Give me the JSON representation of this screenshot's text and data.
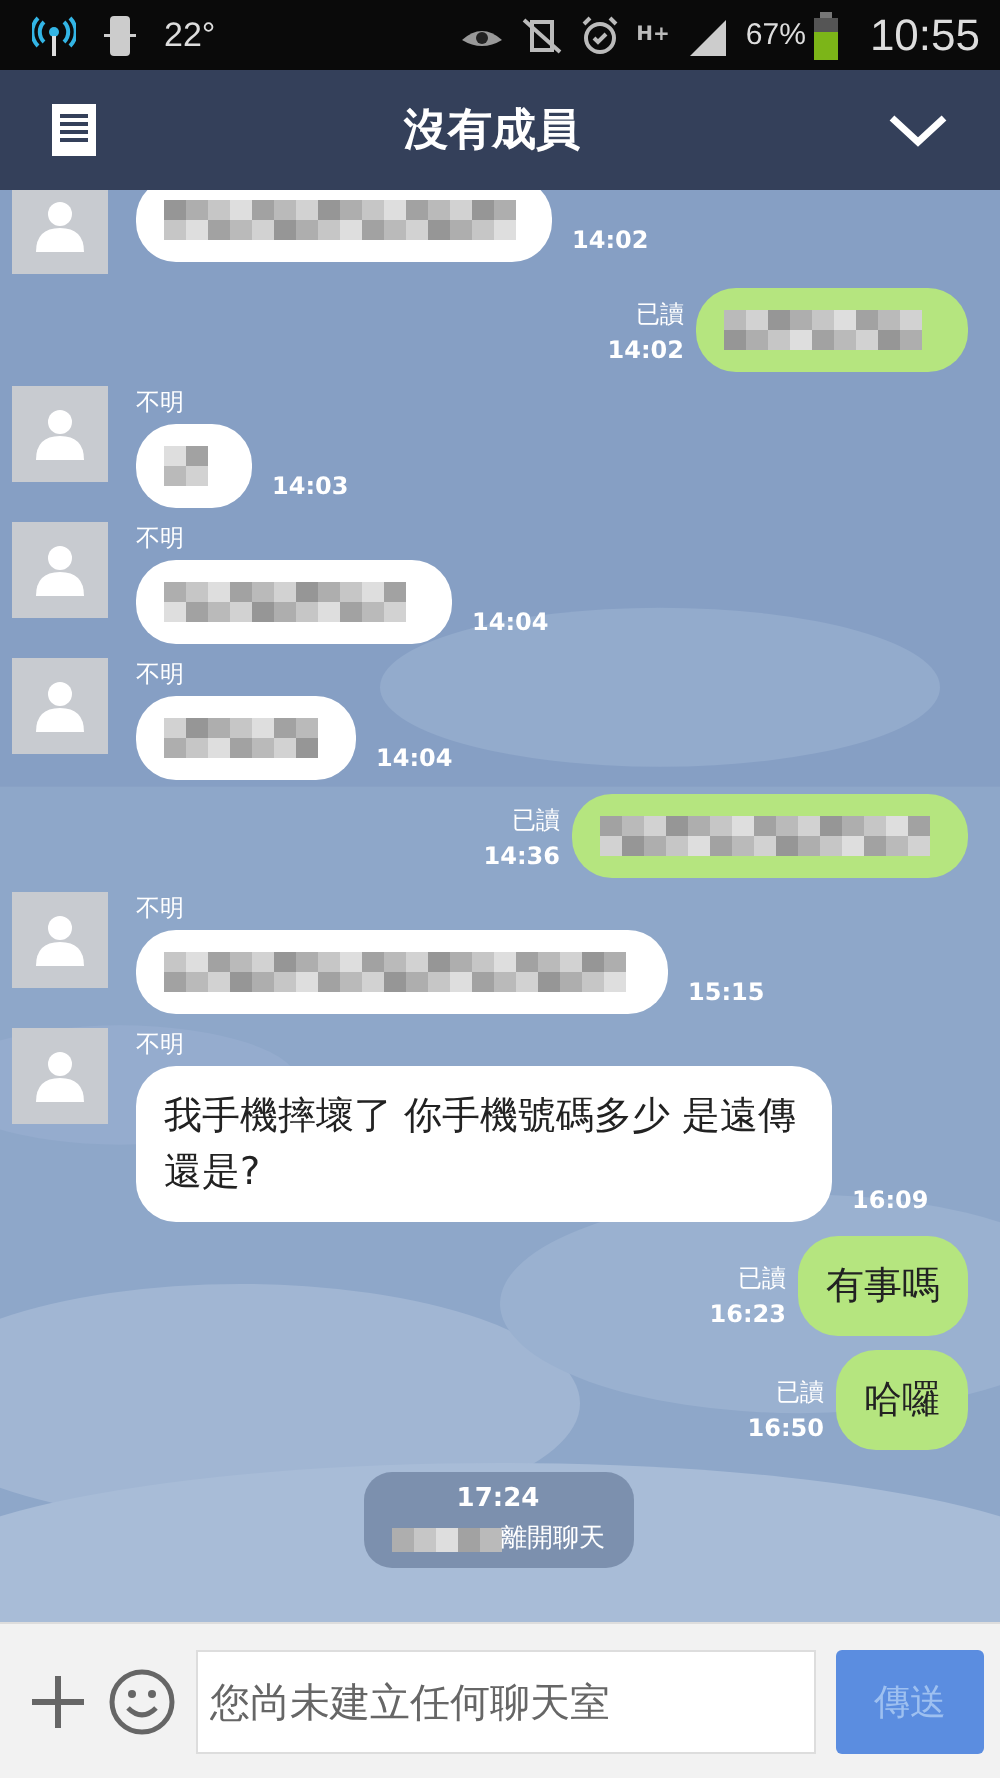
{
  "status_bar": {
    "temperature": "22°",
    "network": "H+",
    "battery": "67%",
    "time": "10:55"
  },
  "header": {
    "title": "沒有成員"
  },
  "messages": [
    {
      "kind": "incoming",
      "time": "14:02"
    },
    {
      "kind": "outgoing",
      "read": "已讀",
      "time": "14:02"
    },
    {
      "kind": "incoming",
      "sender": "不明",
      "time": "14:03"
    },
    {
      "kind": "incoming",
      "sender": "不明",
      "time": "14:04"
    },
    {
      "kind": "incoming",
      "sender": "不明",
      "time": "14:04"
    },
    {
      "kind": "outgoing",
      "read": "已讀",
      "time": "14:36"
    },
    {
      "kind": "incoming",
      "sender": "不明",
      "time": "15:15"
    },
    {
      "kind": "incoming",
      "sender": "不明",
      "text": "我手機摔壞了 你手機號碼多少 是遠傳還是?",
      "time": "16:09"
    },
    {
      "kind": "outgoing",
      "text": "有事嗎",
      "read": "已讀",
      "time": "16:23"
    },
    {
      "kind": "outgoing",
      "text": "哈囉",
      "read": "已讀",
      "time": "16:50"
    },
    {
      "kind": "system",
      "time": "17:24",
      "text": "離開聊天"
    }
  ],
  "composer": {
    "placeholder": "您尚未建立任何聊天室",
    "send": "傳送"
  }
}
